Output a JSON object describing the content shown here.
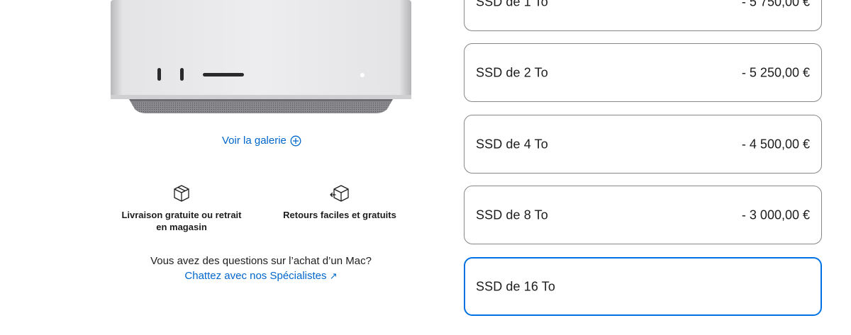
{
  "gallery": {
    "label": "Voir la galerie"
  },
  "features": {
    "delivery_label": "Livraison gratuite ou retrait en magasin",
    "returns_label": "Retours faciles et gratuits"
  },
  "help": {
    "question": "Vous avez des questions sur l’achat d’un Mac?",
    "chat_link": "Chattez avec nos Spécialistes",
    "chat_arrow": "↗"
  },
  "storage_options": [
    {
      "name": "SSD de 1 To",
      "price": "- 5 750,00 €",
      "selected": false
    },
    {
      "name": "SSD de 2 To",
      "price": "- 5 250,00 €",
      "selected": false
    },
    {
      "name": "SSD de 4 To",
      "price": "- 4 500,00 €",
      "selected": false
    },
    {
      "name": "SSD de 8 To",
      "price": "- 3 000,00 €",
      "selected": false
    },
    {
      "name": "SSD de 16 To",
      "price": "",
      "selected": true
    }
  ],
  "colors": {
    "link": "#0066cc",
    "selected_border": "#0071e3",
    "border": "#86868b"
  },
  "icons": {
    "gallery": "plus-circle-icon",
    "delivery": "box-icon",
    "returns": "box-return-icon",
    "chat": "arrow-up-right-icon"
  }
}
